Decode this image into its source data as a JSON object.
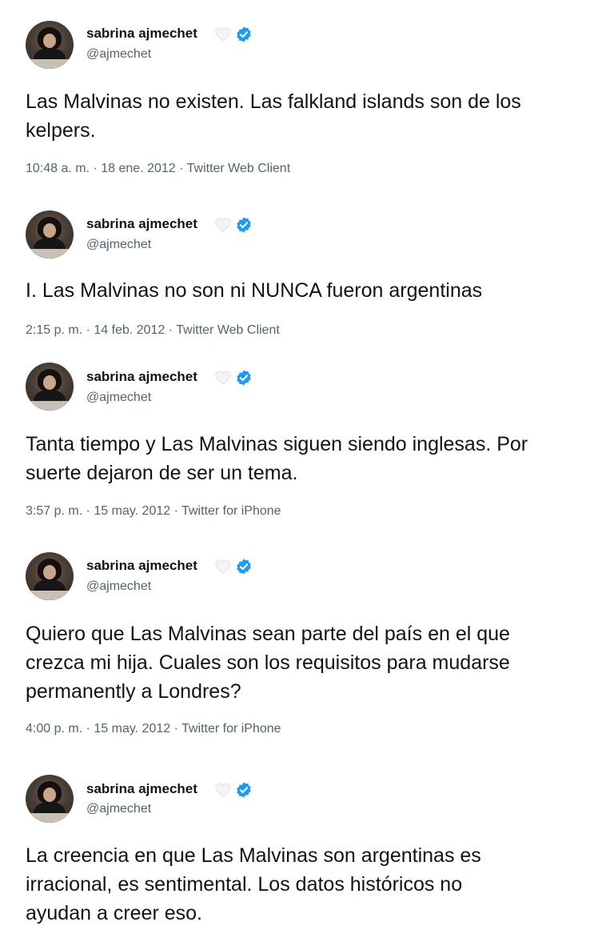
{
  "tweets": [
    {
      "name": "sabrina ajmechet",
      "handle": "@ajmechet",
      "text_lines": [
        "Las Malvinas no existen. Las falkland islands son de los",
        "kelpers."
      ],
      "meta": "10:48 a. m. · 18 ene. 2012 · Twitter Web Client"
    },
    {
      "name": "sabrina ajmechet",
      "handle": "@ajmechet",
      "text_lines": [
        "I. Las Malvinas no son ni NUNCA fueron argentinas"
      ],
      "meta": "2:15 p. m. · 14 feb. 2012 · Twitter Web Client"
    },
    {
      "name": "sabrina ajmechet",
      "handle": "@ajmechet",
      "text_lines": [
        "Tanta tiempo y Las Malvinas siguen siendo inglesas. Por",
        "suerte dejaron de ser un tema."
      ],
      "meta": "3:57 p. m. · 15 may. 2012 · Twitter for iPhone"
    },
    {
      "name": "sabrina ajmechet",
      "handle": "@ajmechet",
      "text_lines": [
        "Quiero que Las Malvinas sean parte del país en el que",
        "crezca mi hija. Cuales son los requisitos para mudarse",
        "permanently a Londres?"
      ],
      "meta": "4:00 p. m. · 15 may. 2012 · Twitter for iPhone"
    },
    {
      "name": "sabrina ajmechet",
      "handle": "@ajmechet",
      "text_lines": [
        "La creencia en que Las Malvinas son argentinas es",
        "irracional, es sentimental. Los datos históricos no",
        "ayudan a creer eso."
      ]
    }
  ],
  "icons": {
    "heart": "white-heart-icon",
    "verified": "verified-badge-icon"
  },
  "colors": {
    "verified_blue": "#1d9bf0",
    "secondary_text": "#536471",
    "primary_text": "#0f1419"
  }
}
